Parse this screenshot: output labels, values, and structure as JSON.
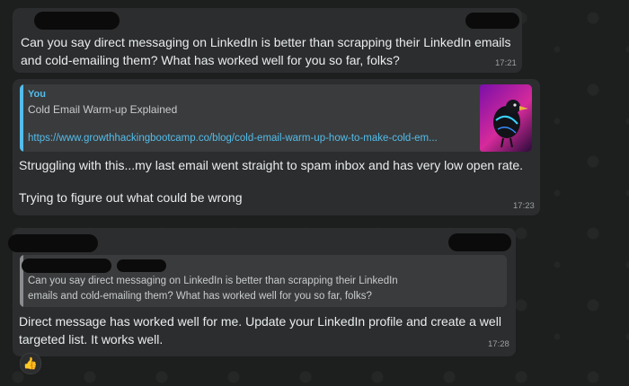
{
  "messages": [
    {
      "text": "Can you say direct messaging on LinkedIn is better than scrapping their LinkedIn emails and cold-emailing them? What has worked well for you so far, folks?",
      "time": "17:21"
    },
    {
      "quote": {
        "author": "You",
        "title": "Cold Email Warm-up Explained",
        "link": "https://www.growthhackingbootcamp.co/blog/cold-email-warm-up-how-to-make-cold-em..."
      },
      "text_line1": "Struggling with this...my last email went straight to spam inbox and has very low open rate.",
      "text_line2": "Trying to figure out what could be wrong",
      "time": "17:23"
    },
    {
      "quote": {
        "text": "Can you say direct messaging on LinkedIn is better than scrapping their LinkedIn emails and cold-emailing them? What has worked well for you so far, folks?"
      },
      "text": "Direct message has worked well for me. Update your LinkedIn profile and create a well targeted list. It works well.",
      "time": "17:28",
      "reaction": "👍"
    }
  ],
  "colors": {
    "link": "#53bdeb",
    "quote_bar_own": "#53bdeb",
    "quote_bar_other": "#8a8d8f",
    "bubble": "#2c2d2e"
  }
}
